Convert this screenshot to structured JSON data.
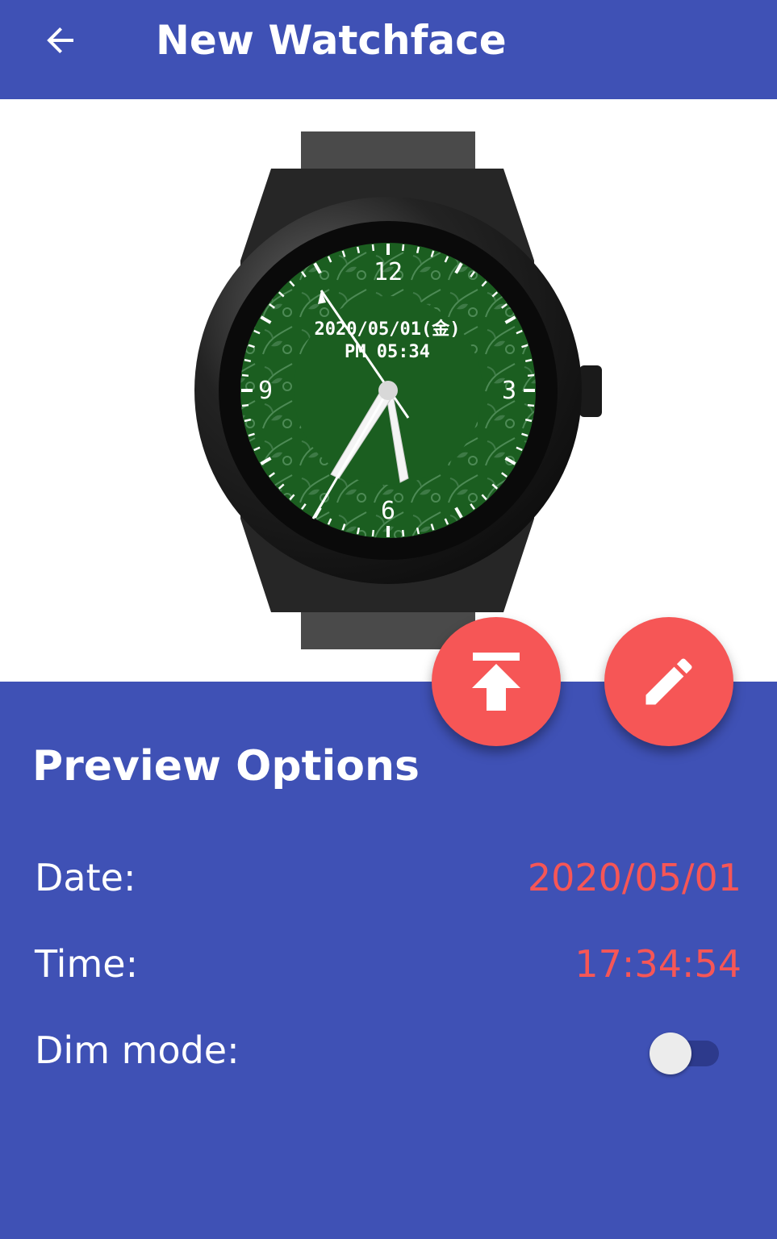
{
  "app_bar": {
    "title": "New Watchface",
    "back_icon": "arrow-back-icon"
  },
  "watch_preview": {
    "date_text": "2020/05/01(金)",
    "time_text": "PM 05:34",
    "numerals": [
      "12",
      "3",
      "6",
      "9"
    ]
  },
  "actions": {
    "upload_icon": "upload-icon",
    "edit_icon": "pencil-icon"
  },
  "preview_options": {
    "title": "Preview Options",
    "date_label": "Date:",
    "date_value": "2020/05/01",
    "time_label": "Time:",
    "time_value": "17:34:54",
    "dim_label": "Dim mode:",
    "dim_enabled": false
  },
  "colors": {
    "primary": "#3f51b5",
    "accent": "#f65656",
    "watch_face": "#1b5e20"
  }
}
